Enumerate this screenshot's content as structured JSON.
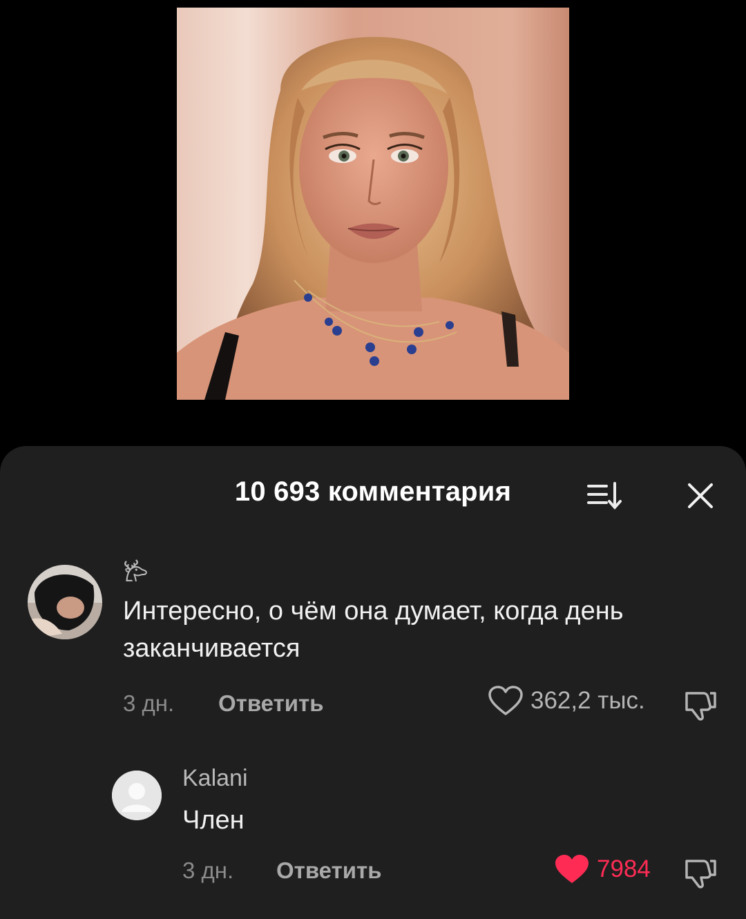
{
  "video": {
    "thumbnail": "portrait-photo"
  },
  "comments_sheet": {
    "title": "10 693 комментария",
    "sort_icon": "sort-icon",
    "close_icon": "close-icon"
  },
  "comments": [
    {
      "username": "𐂂",
      "text": "Интересно, о чём она думает, когда день заканчивается",
      "time": "3 дн.",
      "reply_label": "Ответить",
      "likes": "362,2 тыс.",
      "liked": false
    },
    {
      "username": "Kalani",
      "text": "Член",
      "time": "3 дн.",
      "reply_label": "Ответить",
      "likes": "7984",
      "liked": true
    }
  ],
  "colors": {
    "sheet_bg": "#1f1f1f",
    "like_active": "#fe2c55",
    "text_primary": "#f1f1f1",
    "text_secondary": "#8b8b8b"
  }
}
